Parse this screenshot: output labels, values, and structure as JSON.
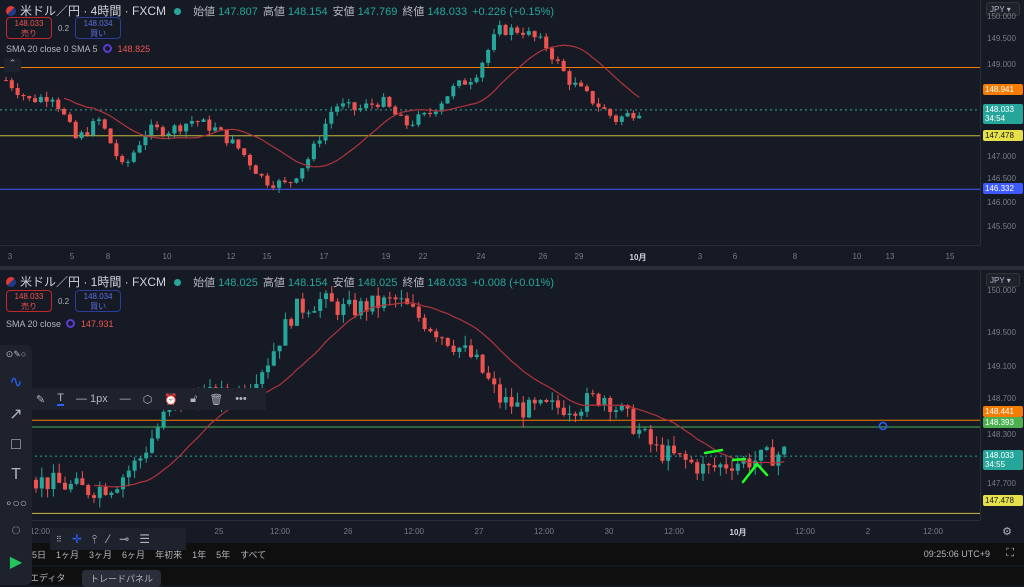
{
  "top": {
    "symbol": "米ドル／円 · 4時間 · FXCM",
    "ohlc": [
      {
        "k": "始値",
        "v": "147.807"
      },
      {
        "k": "高値",
        "v": "148.154"
      },
      {
        "k": "安値",
        "v": "147.769"
      },
      {
        "k": "終値",
        "v": "148.033"
      }
    ],
    "change": "+0.226 (+0.15%)",
    "sell": {
      "price": "148.033",
      "label": "売り"
    },
    "spread": "0.2",
    "buy": {
      "price": "148.034",
      "label": "買い"
    },
    "sma_label": "SMA 20 close 0 SMA 5",
    "sma_value": "148.825",
    "currency": "JPY",
    "price_ticks": [
      "150.000",
      "149.500",
      "149.000",
      "147.000",
      "146.500",
      "146.000",
      "145.500"
    ],
    "price_labels": [
      {
        "text": "148.941",
        "color": "#f57c00"
      },
      {
        "text": "148.033",
        "sub": "34:54",
        "color": "#26a69a"
      },
      {
        "text": "147.478",
        "color": "#e6e14a"
      },
      {
        "text": "146.332",
        "color": "#3d5afe"
      }
    ],
    "time_ticks": [
      "3",
      "5",
      "8",
      "10",
      "12",
      "15",
      "17",
      "19",
      "22",
      "24",
      "26",
      "29",
      "10月",
      "3",
      "6",
      "8",
      "10",
      "13",
      "15"
    ]
  },
  "bottom": {
    "symbol": "米ドル／円 · 1時間 · FXCM",
    "ohlc": [
      {
        "k": "始値",
        "v": "148.025"
      },
      {
        "k": "高値",
        "v": "148.154"
      },
      {
        "k": "安値",
        "v": "148.025"
      },
      {
        "k": "終値",
        "v": "148.033"
      }
    ],
    "change": "+0.008 (+0.01%)",
    "sell": {
      "price": "148.033",
      "label": "売り"
    },
    "spread": "0.2",
    "buy": {
      "price": "148.034",
      "label": "買い"
    },
    "sma_label": "SMA 20 close",
    "sma_value": "147.931",
    "currency": "JPY",
    "price_ticks": [
      "150.000",
      "149.500",
      "149.100",
      "148.700",
      "148.300",
      "147.700"
    ],
    "price_labels": [
      {
        "text": "148.441",
        "color": "#f57c00"
      },
      {
        "text": "148.393",
        "color": "#4caf50"
      },
      {
        "text": "148.033",
        "sub": "34:55",
        "color": "#26a69a"
      },
      {
        "text": "147.478",
        "color": "#e6e14a"
      }
    ],
    "time_ticks": [
      "25",
      "12:00",
      "26",
      "12:00",
      "27",
      "12:00",
      "12:00",
      "30",
      "12:00",
      "10月",
      "12:00",
      "2",
      "12:00"
    ]
  },
  "periods": [
    "5日",
    "1ヶ月",
    "3ヶ月",
    "6ヶ月",
    "年初来",
    "1年",
    "5年",
    "すべて"
  ],
  "clock": "09:25:06 UTC+9",
  "tabs": [
    "エディタ",
    "トレードパネル"
  ],
  "floating_toolbar": {
    "width_label": "1px"
  },
  "colors": {
    "up": "#26a69a",
    "down": "#ef5350",
    "sma": "#b2343a"
  },
  "chart_data": [
    {
      "type": "candlestick",
      "timeframe": "4h",
      "approx_close_path": [
        148.67,
        148.24,
        148.35,
        147.39,
        147.82,
        146.75,
        147.6,
        147.6,
        147.82,
        147.6,
        147.17,
        146.53,
        146.42,
        147.07,
        148.14,
        148.03,
        148.24,
        147.71,
        147.92,
        148.46,
        148.78,
        149.74,
        149.74,
        149.42,
        148.67,
        148.24,
        147.82,
        148.03
      ],
      "ylim": [
        145.3,
        150.1
      ]
    },
    {
      "type": "candlestick",
      "timeframe": "1h",
      "approx_close_path": [
        147.75,
        147.69,
        147.63,
        147.69,
        147.99,
        148.52,
        148.76,
        148.73,
        148.82,
        149.18,
        149.77,
        149.89,
        149.77,
        149.83,
        149.89,
        149.65,
        149.42,
        149.18,
        148.7,
        148.58,
        148.61,
        148.64,
        148.76,
        148.46,
        148.11,
        147.99,
        147.87,
        147.96,
        147.99,
        148.08
      ],
      "ylim": [
        147.3,
        150.0
      ]
    }
  ]
}
